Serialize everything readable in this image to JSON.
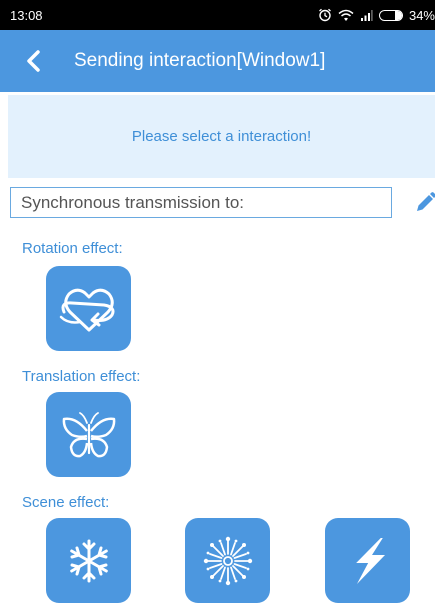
{
  "status_bar": {
    "time": "13:08",
    "battery_text": "34%",
    "icons": [
      "alarm-icon",
      "wifi-icon",
      "signal-icon",
      "battery-icon"
    ]
  },
  "header": {
    "title": "Sending interaction[Window1]",
    "back_icon": "back-chevron-icon"
  },
  "prompt": {
    "text": "Please select a interaction!"
  },
  "sync": {
    "placeholder": "Synchronous transmission to:",
    "edit_icon": "pencil-icon"
  },
  "sections": [
    {
      "label": "Rotation effect:",
      "items": [
        "heart-swirl-icon"
      ]
    },
    {
      "label": "Translation effect:",
      "items": [
        "butterfly-icon"
      ]
    },
    {
      "label": "Scene effect:",
      "items": [
        "snowflake-icon",
        "firework-icon",
        "lightning-icon"
      ]
    }
  ],
  "colors": {
    "accent": "#4c97df",
    "banner_bg": "#e3f1fd",
    "label_text": "#3f8fd7",
    "status_bar": "#000000"
  }
}
